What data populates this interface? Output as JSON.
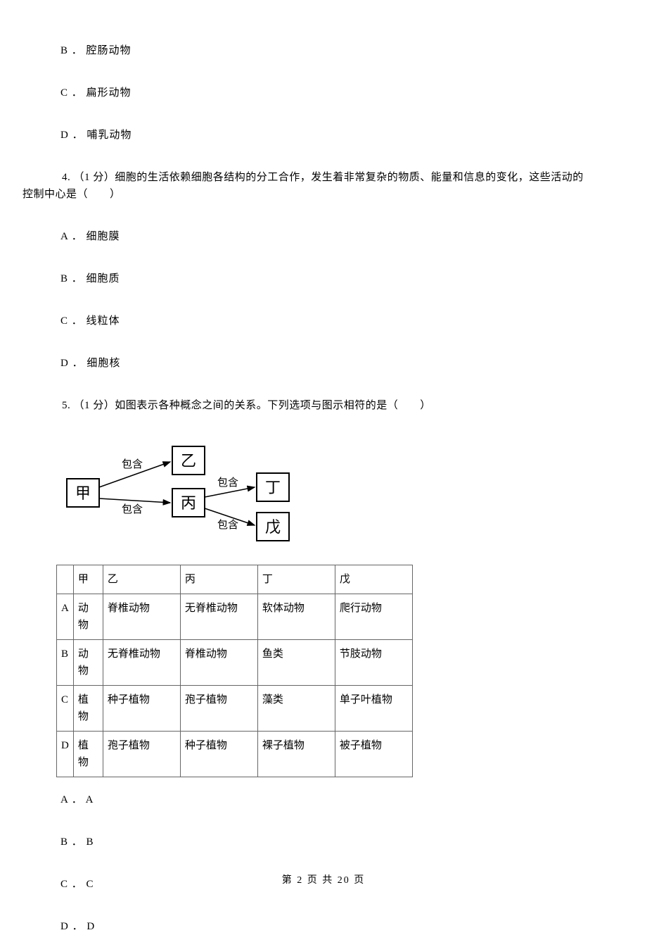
{
  "q3_prev_options": {
    "B": "B ． 腔肠动物",
    "C": "C ． 扁形动物",
    "D": "D ． 哺乳动物"
  },
  "q4": {
    "stem_line1": "4. （1 分）细胞的生活依赖细胞各结构的分工合作，发生着非常复杂的物质、能量和信息的变化，这些活动的",
    "stem_line2": "控制中心是（　　）",
    "options": {
      "A": "A ． 细胞膜",
      "B": "B ． 细胞质",
      "C": "C ． 线粒体",
      "D": "D ． 细胞核"
    }
  },
  "q5": {
    "stem": "5. （1 分）如图表示各种概念之间的关系。下列选项与图示相符的是（　　）",
    "diagram": {
      "nodes": {
        "jia": "甲",
        "yi": "乙",
        "bing": "丙",
        "ding": "丁",
        "wu": "戊"
      },
      "edge_label": "包含"
    },
    "table": {
      "header": [
        "",
        "甲",
        "乙",
        "丙",
        "丁",
        "戊"
      ],
      "rows": [
        [
          "A",
          "动物",
          "脊椎动物",
          "无脊椎动物",
          "软体动物",
          "爬行动物"
        ],
        [
          "B",
          "动物",
          "无脊椎动物",
          "脊椎动物",
          "鱼类",
          "节肢动物"
        ],
        [
          "C",
          "植物",
          "种子植物",
          "孢子植物",
          "藻类",
          "单子叶植物"
        ],
        [
          "D",
          "植物",
          "孢子植物",
          "种子植物",
          "裸子植物",
          "被子植物"
        ]
      ]
    },
    "options": {
      "A": "A ． A",
      "B": "B ． B",
      "C": "C ． C",
      "D": "D ． D"
    }
  },
  "footer": "第 2 页 共 20 页"
}
